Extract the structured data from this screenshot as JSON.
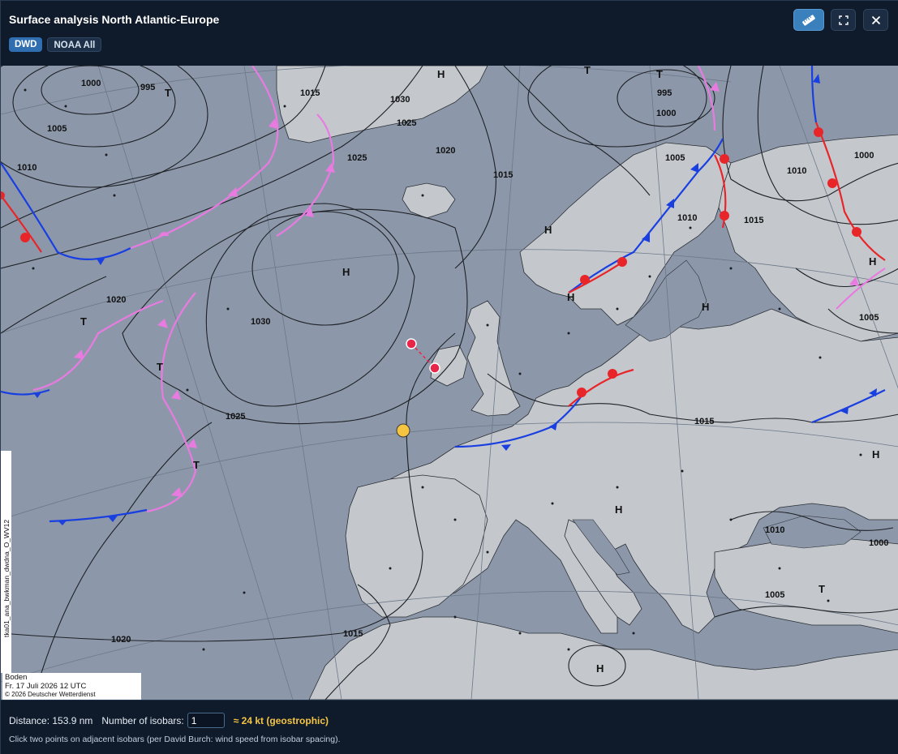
{
  "window": {
    "title": "Surface analysis North Atlantic-Europe",
    "tabs": [
      {
        "label": "DWD",
        "active": true
      },
      {
        "label": "NOAA All",
        "active": false
      }
    ],
    "buttons": {
      "ruler": "ruler-icon",
      "fullscreen": "fullscreen-icon",
      "close": "close-icon"
    }
  },
  "map": {
    "isobar_labels": [
      "1000",
      "995",
      "1005",
      "1010",
      "1015",
      "1030",
      "1025",
      "1020",
      "995",
      "1000",
      "1005",
      "1010",
      "1015",
      "1020",
      "1030",
      "1025",
      "1015",
      "1010",
      "1000",
      "1005",
      "1015",
      "1010",
      "1000",
      "1005",
      "1015",
      "1020",
      "1025"
    ],
    "pressure_centers": [
      "H",
      "T",
      "H",
      "H",
      "T",
      "T",
      "H",
      "H",
      "T",
      "H",
      "H",
      "H",
      "T",
      "T",
      "H",
      "T"
    ],
    "info": {
      "line1": "Boden",
      "line2": "Fr. 17 Juli 2026 12 UTC",
      "line3": "© 2026 Deutscher Wetterdienst"
    },
    "side_label": "tka01_ana_bwkman_dwdna_O_WV12"
  },
  "footer": {
    "distance_label": "Distance: 153.9 nm",
    "isobars_label": "Number of isobars:",
    "isobars_value": "1",
    "geostrophic": "≈ 24 kt (geostrophic)",
    "hint": "Click two points on adjacent isobars (per David Burch: wind speed from isobar spacing)."
  },
  "colors": {
    "accent": "#3a80bd",
    "geostrophic": "#f5c542",
    "warm_front": "#e8262a",
    "cold_front": "#1a3fe0",
    "occlusion": "#e97ae0"
  }
}
